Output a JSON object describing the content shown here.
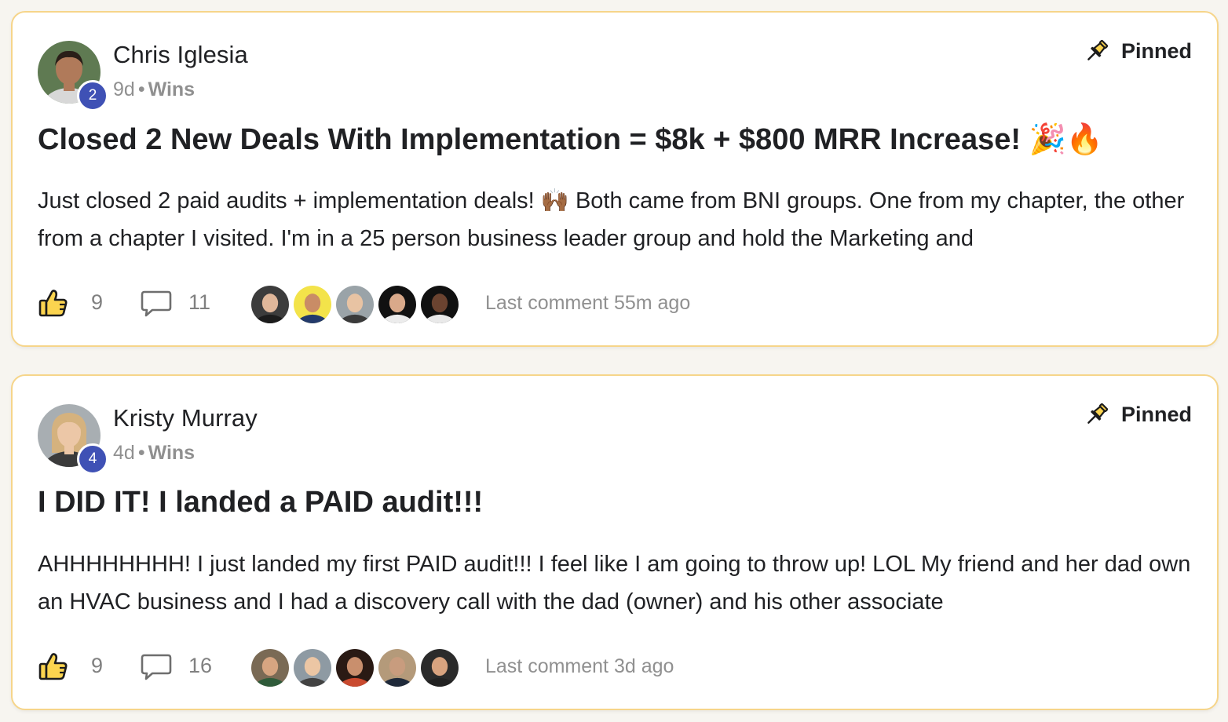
{
  "posts": [
    {
      "author": "Chris Iglesia",
      "level": "2",
      "age": "9d",
      "separator": "•",
      "category": "Wins",
      "pinned_label": "Pinned",
      "title": "Closed 2 New Deals With Implementation = $8k + $800 MRR Increase! 🎉🔥",
      "body": "Just closed 2 paid audits + implementation deals! 🙌🏾 Both came from BNI groups. One from my chapter, the other from a chapter I visited. I'm in a 25 person business leader group and hold the Marketing and",
      "likes": "9",
      "comments": "11",
      "last_comment": "Last comment 55m ago",
      "avatar_colors": {
        "bg": "#5f7a52",
        "skin": "#b07a5a",
        "hair": "#2a1e18",
        "shirt": "#d8d8d8"
      },
      "commenter_colors": [
        {
          "bg": "#3c3c3c",
          "skin": "#e0b79a",
          "shirt": "#1c1c1c"
        },
        {
          "bg": "#f3e34a",
          "skin": "#c98c66",
          "shirt": "#233a6b"
        },
        {
          "bg": "#9aa3a8",
          "skin": "#e8c3a3",
          "shirt": "#3a3a3a"
        },
        {
          "bg": "#111111",
          "skin": "#d9a98a",
          "shirt": "#ececec"
        },
        {
          "bg": "#101010",
          "skin": "#6b4330",
          "shirt": "#e9e9e9"
        }
      ]
    },
    {
      "author": "Kristy Murray",
      "level": "4",
      "age": "4d",
      "separator": "•",
      "category": "Wins",
      "pinned_label": "Pinned",
      "title": "I DID IT! I landed a PAID audit!!!",
      "body": "AHHHHHHHH! I just landed my first PAID audit!!! I feel like I am going to throw up! LOL My friend and her dad own an HVAC business and I had a discovery call with the dad (owner) and his other associate",
      "likes": "9",
      "comments": "16",
      "last_comment": "Last comment 3d ago",
      "avatar_colors": {
        "bg": "#a8aeb2",
        "skin": "#ecc7a7",
        "hair": "#d5b27e",
        "shirt": "#3b3b3b"
      },
      "commenter_colors": [
        {
          "bg": "#7a6a55",
          "skin": "#d7a581",
          "shirt": "#2f5b3a"
        },
        {
          "bg": "#8e9aa3",
          "skin": "#ecc6a4",
          "shirt": "#424242"
        },
        {
          "bg": "#2a1a14",
          "skin": "#c98f6d",
          "shirt": "#c94a2f"
        },
        {
          "bg": "#b49a7a",
          "skin": "#c89c7e",
          "shirt": "#1f2a3a"
        },
        {
          "bg": "#2b2b2b",
          "skin": "#d8a37f",
          "shirt": "#222222"
        }
      ]
    }
  ],
  "colors": {
    "accent": "#f6d58a",
    "level_badge": "#3f51b5",
    "like_fill": "#fbd44f",
    "muted_text": "#909090"
  },
  "icons": {
    "pin": "pin-icon",
    "like": "thumbs-up-icon",
    "comment": "comment-bubble-icon"
  }
}
